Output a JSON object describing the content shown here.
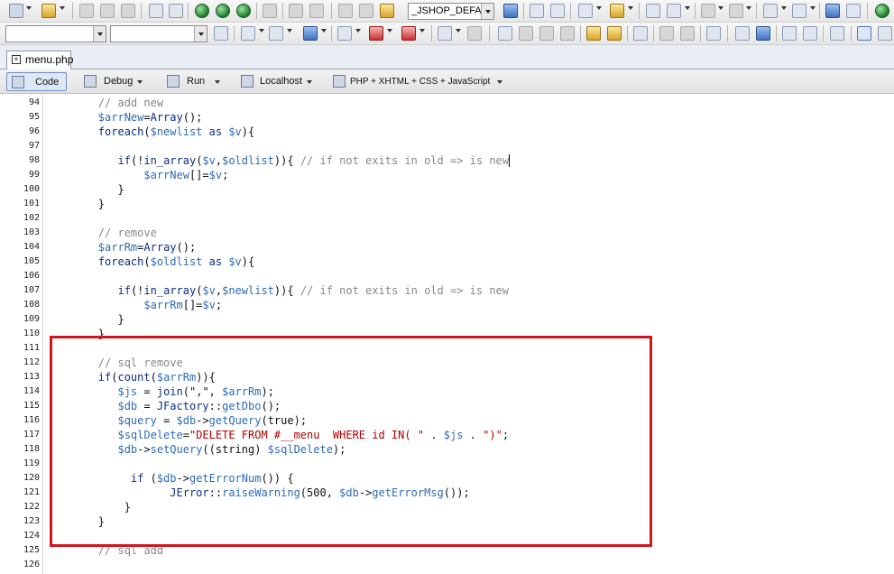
{
  "toolbar": {
    "profile_combo": "_JSHOP_DEFAL",
    "font_combo": "",
    "size_combo": ""
  },
  "tab": {
    "label": "menu.php",
    "close": "×"
  },
  "doc_toolbar": {
    "code": "Code",
    "debug": "Debug",
    "run": "Run",
    "server": "Localhost",
    "language": "PHP + XHTML + CSS + JavaScript"
  },
  "editor": {
    "lines": [
      {
        "n": "94",
        "tokens": [
          {
            "t": "        // add new",
            "c": "cm"
          }
        ]
      },
      {
        "n": "95",
        "tokens": [
          {
            "t": "        ",
            "c": "tx"
          },
          {
            "t": "$arrNew",
            "c": "var"
          },
          {
            "t": "=",
            "c": "tx"
          },
          {
            "t": "Array",
            "c": "fn"
          },
          {
            "t": "();",
            "c": "tx"
          }
        ]
      },
      {
        "n": "96",
        "tokens": [
          {
            "t": "        ",
            "c": "tx"
          },
          {
            "t": "foreach",
            "c": "kw"
          },
          {
            "t": "(",
            "c": "tx"
          },
          {
            "t": "$newlist",
            "c": "var"
          },
          {
            "t": " as ",
            "c": "kw"
          },
          {
            "t": "$v",
            "c": "var"
          },
          {
            "t": "){",
            "c": "tx"
          }
        ]
      },
      {
        "n": "97",
        "tokens": []
      },
      {
        "n": "98",
        "tokens": [
          {
            "t": "           ",
            "c": "tx"
          },
          {
            "t": "if",
            "c": "kw"
          },
          {
            "t": "(!",
            "c": "tx"
          },
          {
            "t": "in_array",
            "c": "fn"
          },
          {
            "t": "(",
            "c": "tx"
          },
          {
            "t": "$v",
            "c": "var"
          },
          {
            "t": ",",
            "c": "tx"
          },
          {
            "t": "$oldlist",
            "c": "var"
          },
          {
            "t": ")){ ",
            "c": "tx"
          },
          {
            "t": "// if not exits in old => is new",
            "c": "cm"
          }
        ]
      },
      {
        "n": "99",
        "tokens": [
          {
            "t": "               ",
            "c": "tx"
          },
          {
            "t": "$arrNew",
            "c": "var"
          },
          {
            "t": "[]=",
            "c": "tx"
          },
          {
            "t": "$v",
            "c": "var"
          },
          {
            "t": ";",
            "c": "tx"
          }
        ]
      },
      {
        "n": "100",
        "tokens": [
          {
            "t": "           }",
            "c": "tx"
          }
        ]
      },
      {
        "n": "101",
        "tokens": [
          {
            "t": "        }",
            "c": "tx"
          }
        ]
      },
      {
        "n": "102",
        "tokens": []
      },
      {
        "n": "103",
        "tokens": [
          {
            "t": "        // remove",
            "c": "cm"
          }
        ]
      },
      {
        "n": "104",
        "tokens": [
          {
            "t": "        ",
            "c": "tx"
          },
          {
            "t": "$arrRm",
            "c": "var"
          },
          {
            "t": "=",
            "c": "tx"
          },
          {
            "t": "Array",
            "c": "fn"
          },
          {
            "t": "();",
            "c": "tx"
          }
        ]
      },
      {
        "n": "105",
        "tokens": [
          {
            "t": "        ",
            "c": "tx"
          },
          {
            "t": "foreach",
            "c": "kw"
          },
          {
            "t": "(",
            "c": "tx"
          },
          {
            "t": "$oldlist",
            "c": "var"
          },
          {
            "t": " as ",
            "c": "kw"
          },
          {
            "t": "$v",
            "c": "var"
          },
          {
            "t": "){",
            "c": "tx"
          }
        ]
      },
      {
        "n": "106",
        "tokens": []
      },
      {
        "n": "107",
        "tokens": [
          {
            "t": "           ",
            "c": "tx"
          },
          {
            "t": "if",
            "c": "kw"
          },
          {
            "t": "(!",
            "c": "tx"
          },
          {
            "t": "in_array",
            "c": "fn"
          },
          {
            "t": "(",
            "c": "tx"
          },
          {
            "t": "$v",
            "c": "var"
          },
          {
            "t": ",",
            "c": "tx"
          },
          {
            "t": "$newlist",
            "c": "var"
          },
          {
            "t": ")){ ",
            "c": "tx"
          },
          {
            "t": "// if not exits in old => is new",
            "c": "cm"
          }
        ]
      },
      {
        "n": "108",
        "tokens": [
          {
            "t": "               ",
            "c": "tx"
          },
          {
            "t": "$arrRm",
            "c": "var"
          },
          {
            "t": "[]=",
            "c": "tx"
          },
          {
            "t": "$v",
            "c": "var"
          },
          {
            "t": ";",
            "c": "tx"
          }
        ]
      },
      {
        "n": "109",
        "tokens": [
          {
            "t": "           }",
            "c": "tx"
          }
        ]
      },
      {
        "n": "110",
        "tokens": [
          {
            "t": "        }",
            "c": "tx"
          }
        ]
      },
      {
        "n": "111",
        "tokens": []
      },
      {
        "n": "112",
        "tokens": [
          {
            "t": "        // sql remove",
            "c": "cm"
          }
        ]
      },
      {
        "n": "113",
        "tokens": [
          {
            "t": "        ",
            "c": "tx"
          },
          {
            "t": "if",
            "c": "kw"
          },
          {
            "t": "(",
            "c": "tx"
          },
          {
            "t": "count",
            "c": "fn"
          },
          {
            "t": "(",
            "c": "tx"
          },
          {
            "t": "$arrRm",
            "c": "var"
          },
          {
            "t": ")){",
            "c": "tx"
          }
        ]
      },
      {
        "n": "114",
        "tokens": [
          {
            "t": "           ",
            "c": "tx"
          },
          {
            "t": "$js",
            "c": "var"
          },
          {
            "t": " = ",
            "c": "tx"
          },
          {
            "t": "join",
            "c": "fn"
          },
          {
            "t": "(\",\", ",
            "c": "tx"
          },
          {
            "t": "$arrRm",
            "c": "var"
          },
          {
            "t": ");",
            "c": "tx"
          }
        ]
      },
      {
        "n": "115",
        "tokens": [
          {
            "t": "           ",
            "c": "tx"
          },
          {
            "t": "$db",
            "c": "var"
          },
          {
            "t": " = ",
            "c": "tx"
          },
          {
            "t": "JFactory",
            "c": "fn"
          },
          {
            "t": "::",
            "c": "tx"
          },
          {
            "t": "getDbo",
            "c": "var"
          },
          {
            "t": "();",
            "c": "tx"
          }
        ]
      },
      {
        "n": "116",
        "tokens": [
          {
            "t": "           ",
            "c": "tx"
          },
          {
            "t": "$query",
            "c": "var"
          },
          {
            "t": " = ",
            "c": "tx"
          },
          {
            "t": "$db",
            "c": "var"
          },
          {
            "t": "->",
            "c": "tx"
          },
          {
            "t": "getQuery",
            "c": "var"
          },
          {
            "t": "(true);",
            "c": "tx"
          }
        ]
      },
      {
        "n": "117",
        "tokens": [
          {
            "t": "           ",
            "c": "tx"
          },
          {
            "t": "$sqlDelete",
            "c": "var"
          },
          {
            "t": "=",
            "c": "tx"
          },
          {
            "t": "\"DELETE FROM #__menu  WHERE id IN( \"",
            "c": "st"
          },
          {
            "t": " . ",
            "c": "tx"
          },
          {
            "t": "$js",
            "c": "var"
          },
          {
            "t": " . ",
            "c": "tx"
          },
          {
            "t": "\")\"",
            "c": "st"
          },
          {
            "t": ";",
            "c": "tx"
          }
        ]
      },
      {
        "n": "118",
        "tokens": [
          {
            "t": "           ",
            "c": "tx"
          },
          {
            "t": "$db",
            "c": "var"
          },
          {
            "t": "->",
            "c": "tx"
          },
          {
            "t": "setQuery",
            "c": "var"
          },
          {
            "t": "((string) ",
            "c": "tx"
          },
          {
            "t": "$sqlDelete",
            "c": "var"
          },
          {
            "t": ");",
            "c": "tx"
          }
        ]
      },
      {
        "n": "119",
        "tokens": []
      },
      {
        "n": "120",
        "tokens": [
          {
            "t": "             ",
            "c": "tx"
          },
          {
            "t": "if",
            "c": "kw"
          },
          {
            "t": " (",
            "c": "tx"
          },
          {
            "t": "$db",
            "c": "var"
          },
          {
            "t": "->",
            "c": "tx"
          },
          {
            "t": "getErrorNum",
            "c": "var"
          },
          {
            "t": "()) {",
            "c": "tx"
          }
        ]
      },
      {
        "n": "121",
        "tokens": [
          {
            "t": "                   ",
            "c": "tx"
          },
          {
            "t": "JError",
            "c": "fn"
          },
          {
            "t": "::",
            "c": "tx"
          },
          {
            "t": "raiseWarning",
            "c": "var"
          },
          {
            "t": "(500, ",
            "c": "tx"
          },
          {
            "t": "$db",
            "c": "var"
          },
          {
            "t": "->",
            "c": "tx"
          },
          {
            "t": "getErrorMsg",
            "c": "var"
          },
          {
            "t": "());",
            "c": "tx"
          }
        ]
      },
      {
        "n": "122",
        "tokens": [
          {
            "t": "            }",
            "c": "tx"
          }
        ]
      },
      {
        "n": "123",
        "tokens": [
          {
            "t": "        }",
            "c": "tx"
          }
        ]
      },
      {
        "n": "124",
        "tokens": []
      },
      {
        "n": "125",
        "tokens": [
          {
            "t": "        // sql add",
            "c": "cm"
          }
        ]
      },
      {
        "n": "126",
        "tokens": []
      }
    ]
  }
}
